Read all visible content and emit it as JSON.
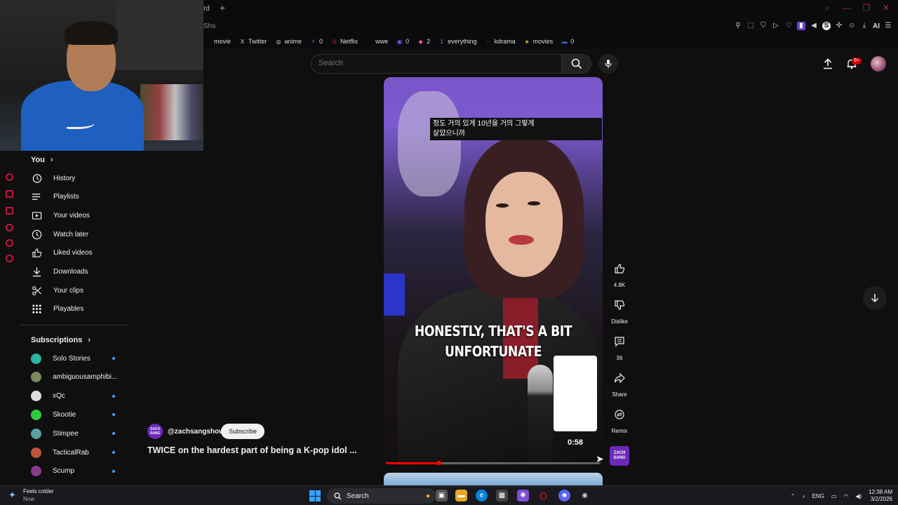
{
  "browser": {
    "tab_fragment": "rd",
    "new_tab_symbol": "+",
    "address_fragment": "Shs",
    "extensions_ai": "AI",
    "window_controls": [
      "search-icon",
      "minimize-icon",
      "restore-icon",
      "close-icon"
    ]
  },
  "bookmarks": [
    {
      "label": "movie",
      "icon": "",
      "color": "#555555"
    },
    {
      "label": "Twitter",
      "icon": "X",
      "color": "#dddddd"
    },
    {
      "label": "anime",
      "icon": "◎",
      "color": "#dddddd"
    },
    {
      "label": "0",
      "icon": "⚡",
      "color": "#1d9bf0"
    },
    {
      "label": "Netflix",
      "icon": "N",
      "color": "#e50914"
    },
    {
      "label": "wwe",
      "icon": "",
      "color": "#0b0b0d"
    },
    {
      "label": "0",
      "icon": "▣",
      "color": "#9146ff"
    },
    {
      "label": "2",
      "icon": "◆",
      "color": "#ff4fb4"
    },
    {
      "label": "everything",
      "icon": "1",
      "color": "#3ea6ff"
    },
    {
      "label": "kdrama",
      "icon": "··",
      "color": "#ff9900"
    },
    {
      "label": "movies",
      "icon": "♣",
      "color": "#c79a5d"
    },
    {
      "label": "0",
      "icon": "▬",
      "color": "#3b6bd8"
    }
  ],
  "search": {
    "placeholder": "Search"
  },
  "header": {
    "notifications_badge": "9+"
  },
  "sidebar": {
    "you_header": "You",
    "you_chevron": "›",
    "you_items": [
      {
        "label": "History",
        "icon": "history-icon"
      },
      {
        "label": "Playlists",
        "icon": "playlists-icon"
      },
      {
        "label": "Your videos",
        "icon": "your-videos-icon"
      },
      {
        "label": "Watch later",
        "icon": "watch-later-icon"
      },
      {
        "label": "Liked videos",
        "icon": "thumbs-up-icon"
      },
      {
        "label": "Downloads",
        "icon": "download-icon"
      },
      {
        "label": "Your clips",
        "icon": "scissors-icon"
      },
      {
        "label": "Playables",
        "icon": "playables-icon"
      }
    ],
    "subs_header": "Subscriptions",
    "subs_chevron": "›",
    "subscriptions": [
      {
        "name": "Solo Stories",
        "color": "#2bb3a3",
        "new": true
      },
      {
        "name": "ambiguousamphibi...",
        "color": "#7a8a5a",
        "new": false
      },
      {
        "name": "xQc",
        "color": "#dddddd",
        "new": true
      },
      {
        "name": "Skootie",
        "color": "#2ecc40",
        "new": true
      },
      {
        "name": "Stimpee",
        "color": "#5aa0a0",
        "new": true
      },
      {
        "name": "TacticalRab",
        "color": "#c0533a",
        "new": true
      },
      {
        "name": "Scump",
        "color": "#8a3a8a",
        "new": true
      }
    ]
  },
  "short": {
    "korean_subtitle_line1": "정도 거의 있게 10년을 거의 그렇게",
    "korean_subtitle_line2": "살았으니까",
    "caption_line1": "HONESTLY, THAT'S A BIT",
    "caption_line2": "UNFORTUNATE",
    "duration": "0:58",
    "progress": 0.25,
    "channel_handle": "@zachsangshow",
    "channel_avatar_text": "ZACH SANG",
    "subscribe_label": "Subscribe",
    "title": "TWICE on the hardest part of being a K-pop idol ..."
  },
  "actions": {
    "like_count": "4.8K",
    "dislike_label": "Dislike",
    "comment_count": "36",
    "share_label": "Share",
    "remix_label": "Remix",
    "channel_thumb_text": "ZACH SANG"
  },
  "taskbar": {
    "weather_line1": "Feels colder",
    "weather_line2": "Now",
    "search_label": "Search",
    "lang": "ENG",
    "time": "12:38 AM",
    "date": "3/2/2026"
  }
}
